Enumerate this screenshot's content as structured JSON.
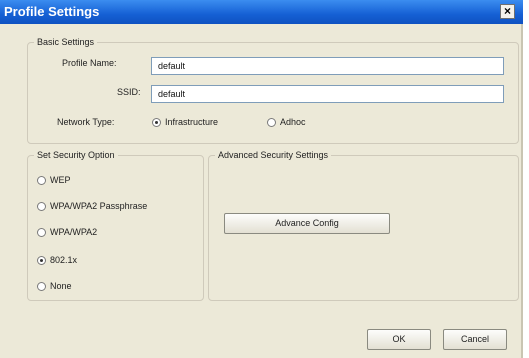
{
  "window": {
    "title": "Profile Settings",
    "close_glyph": "×"
  },
  "basic_settings": {
    "legend": "Basic Settings",
    "profile_name_label": "Profile Name:",
    "profile_name_value": "default",
    "ssid_label": "SSID:",
    "ssid_value": "default",
    "network_type_label": "Network Type:",
    "network_type_options": [
      {
        "label": "Infrastructure",
        "selected": true
      },
      {
        "label": "Adhoc",
        "selected": false
      }
    ]
  },
  "security": {
    "legend": "Set Security Option",
    "options": [
      {
        "label": "WEP",
        "selected": false
      },
      {
        "label": "WPA/WPA2 Passphrase",
        "selected": false
      },
      {
        "label": "WPA/WPA2",
        "selected": false
      },
      {
        "label": "802.1x",
        "selected": true
      },
      {
        "label": "None",
        "selected": false
      }
    ]
  },
  "advanced": {
    "legend": "Advanced Security Settings",
    "config_button": "Advance Config"
  },
  "footer": {
    "ok_label": "OK",
    "cancel_label": "Cancel"
  }
}
